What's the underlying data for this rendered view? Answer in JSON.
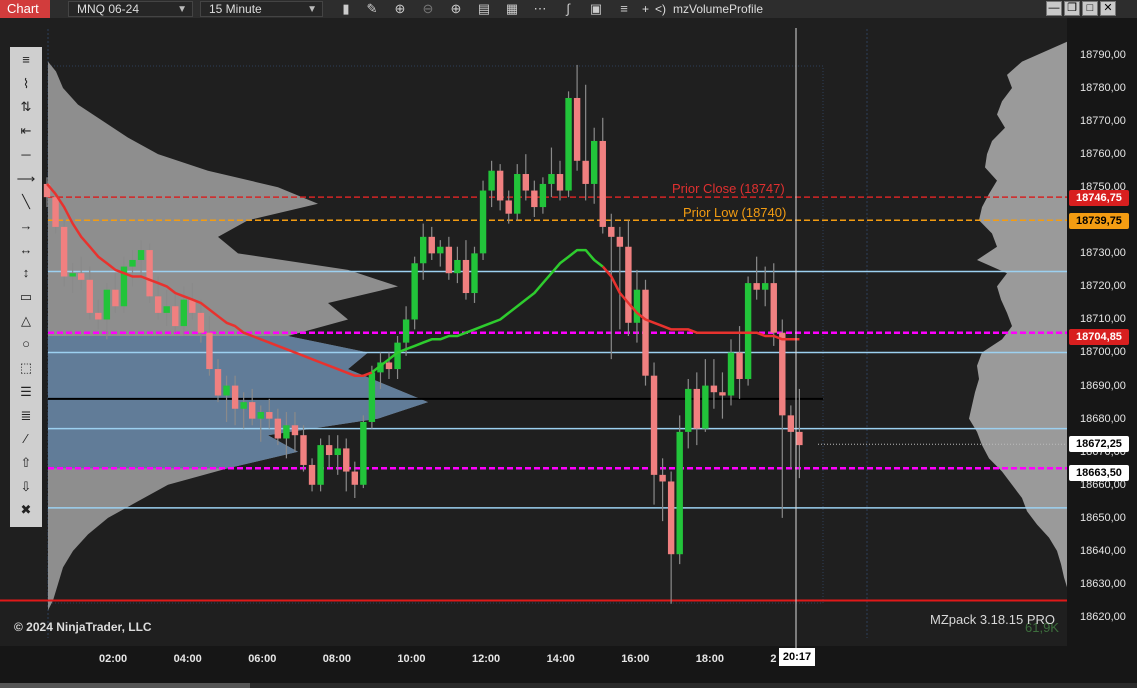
{
  "toolbar": {
    "tab_label": "Chart",
    "instrument": "MNQ 06-24",
    "interval": "15 Minute",
    "plus": "+",
    "arrow": "<)",
    "indicator": "mzVolumeProfile",
    "icons": [
      "bar-chart-icon",
      "pencil-icon",
      "zoom-in-icon",
      "zoom-out-icon",
      "crosshair-icon",
      "properties-icon",
      "data-box-icon",
      "strategy-icon",
      "indicator-icon",
      "template-icon"
    ]
  },
  "drawing_tools": [
    "ruler-icon",
    "risk-reward-icon",
    "vertical-arrows-icon",
    "extended-line-icon",
    "line-icon",
    "ray-icon",
    "diagonal-line-icon",
    "arrow-line-icon",
    "horizontal-line-icon",
    "vertical-line-icon",
    "rectangle-icon",
    "triangle-icon",
    "ellipse-icon",
    "region-icon",
    "fibonacci-icon",
    "fibonacci-extension-icon",
    "parallel-lines-icon",
    "arrow-up-icon",
    "arrow-down-icon",
    "trash-icon"
  ],
  "price_axis": {
    "ticks": [
      "18790,00",
      "18780,00",
      "18770,00",
      "18760,00",
      "18750,00",
      "18740,00",
      "18730,00",
      "18720,00",
      "18710,00",
      "18700,00",
      "18690,00",
      "18680,00",
      "18670,00",
      "18660,00",
      "18650,00",
      "18640,00",
      "18630,00",
      "18620,00"
    ],
    "tags": [
      {
        "value": "18746,75",
        "bg": "#d81f1f",
        "fg": "#ffffff"
      },
      {
        "value": "18739,75",
        "bg": "#f39c12",
        "fg": "#000000"
      },
      {
        "value": "18704,85",
        "bg": "#d81f1f",
        "fg": "#ffffff"
      },
      {
        "value": "18672,25",
        "bg": "#ffffff",
        "fg": "#000000"
      },
      {
        "value": "18663,50",
        "bg": "#ffffff",
        "fg": "#000000"
      }
    ]
  },
  "time_axis": {
    "ticks": [
      "02:00",
      "04:00",
      "06:00",
      "08:00",
      "10:00",
      "12:00",
      "14:00",
      "16:00",
      "18:00",
      "2"
    ],
    "cursor": "20:17"
  },
  "levels": {
    "prior_close": "Prior Close (18747)",
    "prior_low": "Prior Low (18740)"
  },
  "footer": {
    "copyright": "© 2024 NinjaTrader, LLC",
    "mzpack": "MZpack 3.18.15 PRO",
    "volume": "61,9K"
  },
  "colors": {
    "up": "#22c43a",
    "down": "#f08080",
    "ma": "#e8322e",
    "ma_green": "#2ecc2e",
    "profile": "#9a9a9a",
    "value_area": "#5c7a99",
    "magenta": "#ff00ff",
    "light_blue": "#9cd0f0"
  },
  "chart_data": {
    "type": "candlestick",
    "symbol": "MNQ 06-24",
    "interval": "15 Minute",
    "candles": [
      [
        18751,
        18753,
        18744,
        18747
      ],
      [
        18747,
        18749,
        18736,
        18738
      ],
      [
        18738,
        18740,
        18720,
        18723
      ],
      [
        18723,
        18727,
        18718,
        18724
      ],
      [
        18724,
        18729,
        18719,
        18722
      ],
      [
        18722,
        18726,
        18710,
        18712
      ],
      [
        18712,
        18716,
        18707,
        18710
      ],
      [
        18710,
        18721,
        18704,
        18719
      ],
      [
        18719,
        18724,
        18712,
        18714
      ],
      [
        18714,
        18729,
        18712,
        18726
      ],
      [
        18726,
        18731,
        18720,
        18728
      ],
      [
        18728,
        18734,
        18722,
        18731
      ],
      [
        18731,
        18733,
        18715,
        18717
      ],
      [
        18717,
        18723,
        18710,
        18712
      ],
      [
        18712,
        18719,
        18708,
        18714
      ],
      [
        18714,
        18718,
        18706,
        18708
      ],
      [
        18708,
        18720,
        18705,
        18716
      ],
      [
        18716,
        18721,
        18710,
        18712
      ],
      [
        18712,
        18716,
        18703,
        18706
      ],
      [
        18706,
        18711,
        18693,
        18695
      ],
      [
        18695,
        18698,
        18685,
        18687
      ],
      [
        18687,
        18693,
        18679,
        18690
      ],
      [
        18690,
        18693,
        18678,
        18683
      ],
      [
        18683,
        18688,
        18677,
        18685
      ],
      [
        18685,
        18689,
        18678,
        18680
      ],
      [
        18680,
        18684,
        18673,
        18682
      ],
      [
        18682,
        18686,
        18677,
        18680
      ],
      [
        18680,
        18683,
        18672,
        18674
      ],
      [
        18674,
        18682,
        18668,
        18678
      ],
      [
        18678,
        18682,
        18670,
        18675
      ],
      [
        18675,
        18678,
        18664,
        18666
      ],
      [
        18666,
        18668,
        18658,
        18660
      ],
      [
        18660,
        18674,
        18658,
        18672
      ],
      [
        18672,
        18675,
        18665,
        18669
      ],
      [
        18669,
        18675,
        18663,
        18671
      ],
      [
        18671,
        18674,
        18658,
        18664
      ],
      [
        18664,
        18667,
        18656,
        18660
      ],
      [
        18660,
        18681,
        18659,
        18679
      ],
      [
        18679,
        18696,
        18677,
        18694
      ],
      [
        18694,
        18700,
        18689,
        18697
      ],
      [
        18697,
        18700,
        18692,
        18695
      ],
      [
        18695,
        18705,
        18692,
        18703
      ],
      [
        18703,
        18714,
        18699,
        18710
      ],
      [
        18710,
        18729,
        18707,
        18727
      ],
      [
        18727,
        18739,
        18722,
        18735
      ],
      [
        18735,
        18738,
        18728,
        18730
      ],
      [
        18730,
        18734,
        18726,
        18732
      ],
      [
        18732,
        18735,
        18722,
        18724
      ],
      [
        18724,
        18732,
        18721,
        18728
      ],
      [
        18728,
        18734,
        18716,
        18718
      ],
      [
        18718,
        18732,
        18715,
        18730
      ],
      [
        18730,
        18752,
        18728,
        18749
      ],
      [
        18749,
        18758,
        18744,
        18755
      ],
      [
        18755,
        18757,
        18743,
        18746
      ],
      [
        18746,
        18749,
        18739,
        18742
      ],
      [
        18742,
        18757,
        18740,
        18754
      ],
      [
        18754,
        18760,
        18746,
        18749
      ],
      [
        18749,
        18752,
        18741,
        18744
      ],
      [
        18744,
        18753,
        18742,
        18751
      ],
      [
        18751,
        18762,
        18747,
        18754
      ],
      [
        18754,
        18758,
        18746,
        18749
      ],
      [
        18749,
        18779,
        18747,
        18777
      ],
      [
        18777,
        18787,
        18755,
        18758
      ],
      [
        18758,
        18781,
        18746,
        18751
      ],
      [
        18751,
        18768,
        18745,
        18764
      ],
      [
        18764,
        18771,
        18736,
        18738
      ],
      [
        18738,
        18742,
        18698,
        18735
      ],
      [
        18735,
        18738,
        18707,
        18732
      ],
      [
        18732,
        18740,
        18705,
        18709
      ],
      [
        18709,
        18725,
        18703,
        18719
      ],
      [
        18719,
        18722,
        18690,
        18693
      ],
      [
        18693,
        18697,
        18654,
        18663
      ],
      [
        18663,
        18668,
        18649,
        18661
      ],
      [
        18661,
        18664,
        18624,
        18639
      ],
      [
        18639,
        18681,
        18636,
        18676
      ],
      [
        18676,
        18692,
        18671,
        18689
      ],
      [
        18689,
        18694,
        18672,
        18677
      ],
      [
        18677,
        18698,
        18676,
        18690
      ],
      [
        18690,
        18698,
        18683,
        18688
      ],
      [
        18688,
        18694,
        18680,
        18687
      ],
      [
        18687,
        18704,
        18684,
        18700
      ],
      [
        18700,
        18708,
        18686,
        18692
      ],
      [
        18692,
        18723,
        18690,
        18721
      ],
      [
        18721,
        18729,
        18716,
        18719
      ],
      [
        18719,
        18726,
        18714,
        18721
      ],
      [
        18721,
        18727,
        18702,
        18706
      ],
      [
        18706,
        18710,
        18650,
        18681
      ],
      [
        18681,
        18684,
        18665,
        18676
      ],
      [
        18676,
        18689,
        18662,
        18672
      ]
    ],
    "moving_average": [
      18751,
      18748,
      18744,
      18739,
      18735,
      18732,
      18729,
      18727,
      18725,
      18724,
      18723,
      18723,
      18722,
      18721,
      18720,
      18718,
      18717,
      18716,
      18715,
      18713,
      18711,
      18709,
      18708,
      18706,
      18705,
      18704,
      18703,
      18702,
      18701,
      18700,
      18699,
      18698,
      18697,
      18696,
      18695,
      18694,
      18693,
      18693,
      18694,
      18696,
      18698,
      18700,
      18701,
      18702,
      18703,
      18704,
      18704,
      18705,
      18705,
      18706,
      18707,
      18708,
      18709,
      18710,
      18712,
      18714,
      18716,
      18718,
      18721,
      18724,
      18727,
      18729,
      18731,
      18731,
      18728,
      18726,
      18723,
      18718,
      18715,
      18712,
      18710,
      18709,
      18708,
      18707,
      18707,
      18707,
      18706,
      18706,
      18706,
      18706,
      18706,
      18706,
      18706,
      18706,
      18705,
      18705,
      18704,
      18704,
      18704
    ],
    "ma_green_range": [
      38,
      65
    ],
    "horizontal_levels": [
      {
        "price": 18747,
        "color": "#d42525",
        "style": "dashed"
      },
      {
        "price": 18740,
        "color": "#f39c12",
        "style": "dashed"
      },
      {
        "price": 18724.5,
        "color": "#9cd0f0",
        "style": "solid"
      },
      {
        "price": 18706,
        "color": "#ff00ff",
        "style": "dashed"
      },
      {
        "price": 18700,
        "color": "#9cd0f0",
        "style": "solid"
      },
      {
        "price": 18686,
        "color": "#000000",
        "style": "solid"
      },
      {
        "price": 18677,
        "color": "#9cd0f0",
        "style": "solid"
      },
      {
        "price": 18665,
        "color": "#ff00ff",
        "style": "dashed"
      },
      {
        "price": 18653,
        "color": "#9cd0f0",
        "style": "solid"
      },
      {
        "price": 18625,
        "color": "#e01818",
        "style": "solid"
      }
    ],
    "volume_profile_session": [
      [
        18785,
        8
      ],
      [
        18780,
        15
      ],
      [
        18775,
        30
      ],
      [
        18770,
        55
      ],
      [
        18765,
        80
      ],
      [
        18760,
        110
      ],
      [
        18755,
        160
      ],
      [
        18750,
        230
      ],
      [
        18745,
        270
      ],
      [
        18740,
        200
      ],
      [
        18735,
        170
      ],
      [
        18730,
        190
      ],
      [
        18725,
        300
      ],
      [
        18720,
        350
      ],
      [
        18715,
        280
      ],
      [
        18710,
        300
      ],
      [
        18705,
        240
      ],
      [
        18700,
        320
      ],
      [
        18695,
        300
      ],
      [
        18690,
        340
      ],
      [
        18685,
        380
      ],
      [
        18680,
        330
      ],
      [
        18675,
        220
      ],
      [
        18670,
        250
      ],
      [
        18665,
        180
      ],
      [
        18660,
        120
      ],
      [
        18655,
        90
      ],
      [
        18650,
        60
      ],
      [
        18645,
        40
      ],
      [
        18640,
        25
      ],
      [
        18635,
        15
      ],
      [
        18630,
        10
      ],
      [
        18625,
        5
      ]
    ],
    "volume_profile_value_area": [
      18665,
      18705
    ],
    "volume_profile_right": [
      [
        18792,
        15
      ],
      [
        18788,
        45
      ],
      [
        18784,
        60
      ],
      [
        18780,
        55
      ],
      [
        18776,
        65
      ],
      [
        18772,
        70
      ],
      [
        18768,
        62
      ],
      [
        18764,
        75
      ],
      [
        18760,
        80
      ],
      [
        18756,
        82
      ],
      [
        18752,
        70
      ],
      [
        18748,
        78
      ],
      [
        18744,
        85
      ],
      [
        18740,
        88
      ],
      [
        18736,
        75
      ],
      [
        18732,
        70
      ],
      [
        18728,
        90
      ],
      [
        18724,
        60
      ],
      [
        18720,
        70
      ],
      [
        18716,
        66
      ],
      [
        18712,
        60
      ],
      [
        18708,
        55
      ],
      [
        18704,
        65
      ],
      [
        18700,
        85
      ],
      [
        18696,
        90
      ],
      [
        18692,
        88
      ],
      [
        18688,
        92
      ],
      [
        18684,
        95
      ],
      [
        18680,
        98
      ],
      [
        18676,
        90
      ],
      [
        18672,
        85
      ],
      [
        18668,
        78
      ],
      [
        18664,
        65
      ],
      [
        18660,
        55
      ],
      [
        18656,
        45
      ],
      [
        18652,
        40
      ],
      [
        18648,
        30
      ],
      [
        18644,
        18
      ],
      [
        18640,
        10
      ],
      [
        18636,
        6
      ],
      [
        18632,
        3
      ]
    ]
  }
}
